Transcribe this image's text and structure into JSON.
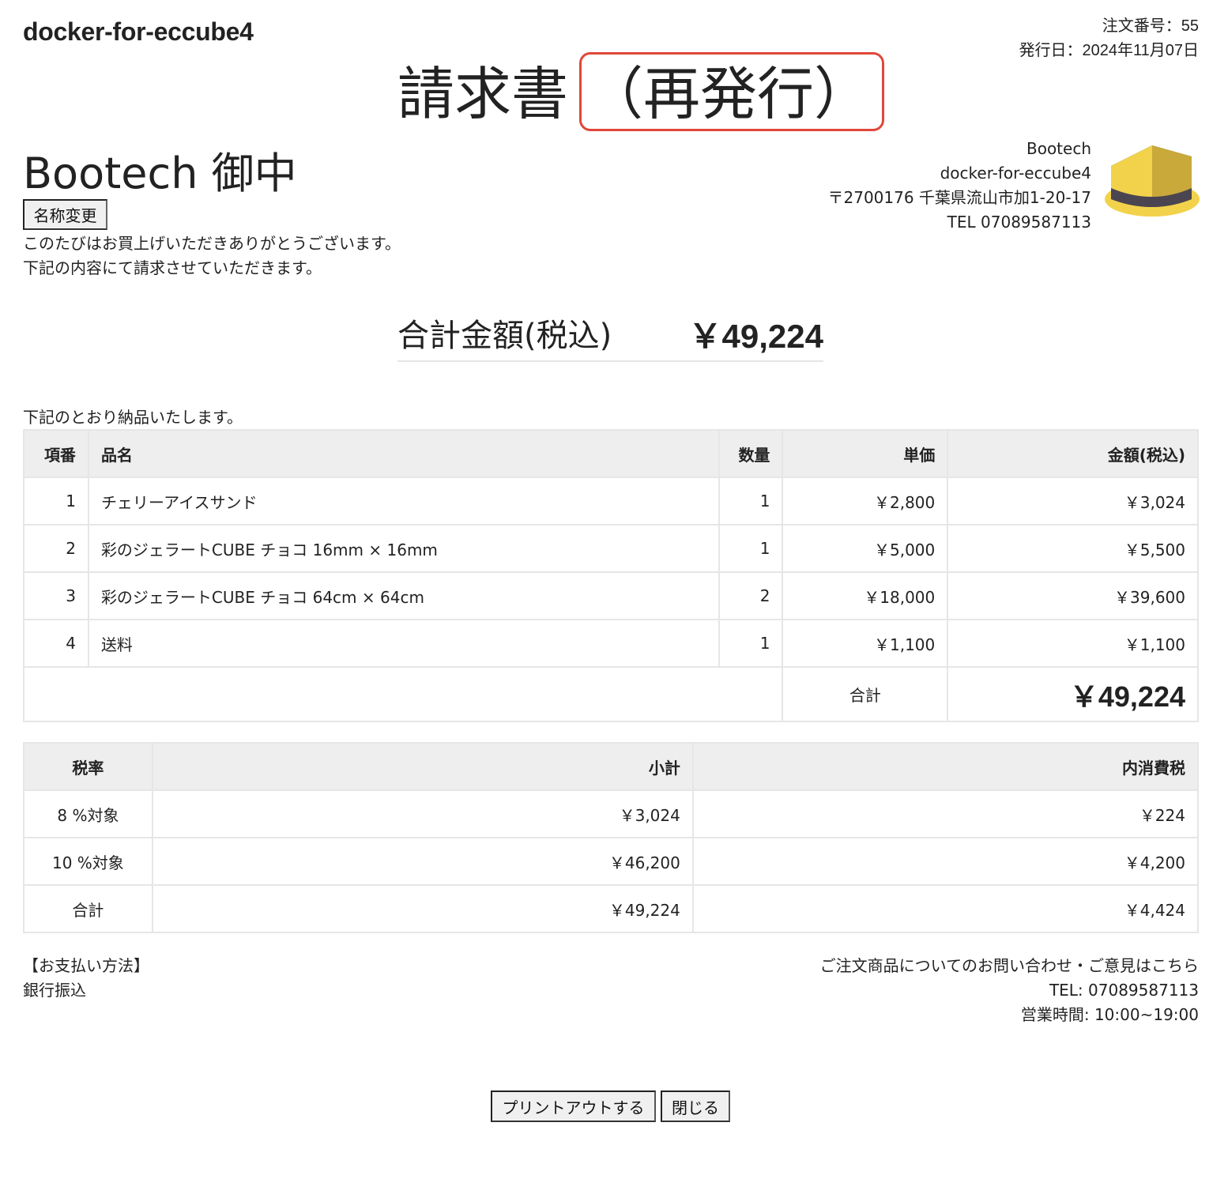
{
  "header": {
    "shop_name": "docker-for-eccube4",
    "order_number": "注文番号：55",
    "issue_date": "発行日：2024年11月07日"
  },
  "title": {
    "main": "請求書",
    "reissue": "（再発行）"
  },
  "recipient": {
    "name": "Bootech 御中",
    "rename_button": "名称変更",
    "greeting_line1": "このたびはお買上げいただきありがとうございます。",
    "greeting_line2": "下記の内容にて請求させていただきます。"
  },
  "issuer": {
    "company": "Bootech",
    "shop": "docker-for-eccube4",
    "address": "〒2700176 千葉県流山市加1-20-17",
    "tel": "TEL 07089587113",
    "logo_icon": "yellow-hat-logo-icon",
    "colors": {
      "hat_yellow": "#f2d24a",
      "hat_band": "#4a4550"
    }
  },
  "total": {
    "label": "合計金額(税込)",
    "value": "￥49,224"
  },
  "deliver_note": "下記のとおり納品いたします。",
  "items_table": {
    "headers": [
      "項番",
      "品名",
      "数量",
      "単価",
      "金額(税込)"
    ],
    "rows": [
      {
        "no": "1",
        "name": "チェリーアイスサンド",
        "qty": "1",
        "unit": "￥2,800",
        "amount": "￥3,024"
      },
      {
        "no": "2",
        "name": "彩のジェラートCUBE チョコ 16mm × 16mm",
        "qty": "1",
        "unit": "￥5,000",
        "amount": "￥5,500"
      },
      {
        "no": "3",
        "name": "彩のジェラートCUBE チョコ 64cm × 64cm",
        "qty": "2",
        "unit": "￥18,000",
        "amount": "￥39,600"
      },
      {
        "no": "4",
        "name": "送料",
        "qty": "1",
        "unit": "￥1,100",
        "amount": "￥1,100"
      }
    ],
    "sum_label": "合計",
    "sum_value": "￥49,224"
  },
  "tax_table": {
    "headers": [
      "税率",
      "小計",
      "内消費税"
    ],
    "rows": [
      {
        "rate": "8 %対象",
        "subtotal": "￥3,024",
        "tax": "￥224"
      },
      {
        "rate": "10 %対象",
        "subtotal": "￥46,200",
        "tax": "￥4,200"
      },
      {
        "rate": "合計",
        "subtotal": "￥49,224",
        "tax": "￥4,424"
      }
    ]
  },
  "payment": {
    "label": "【お支払い方法】",
    "method": "銀行振込"
  },
  "contact": {
    "line1": "ご注文商品についてのお問い合わせ・ご意見はこちら",
    "tel": "TEL: 07089587113",
    "hours": "営業時間: 10:00~19:00"
  },
  "buttons": {
    "print": "プリントアウトする",
    "close": "閉じる"
  },
  "colors": {
    "reissue_border": "#e0473a",
    "table_header_bg": "#eeeeee",
    "table_border": "#e6e6e6"
  }
}
